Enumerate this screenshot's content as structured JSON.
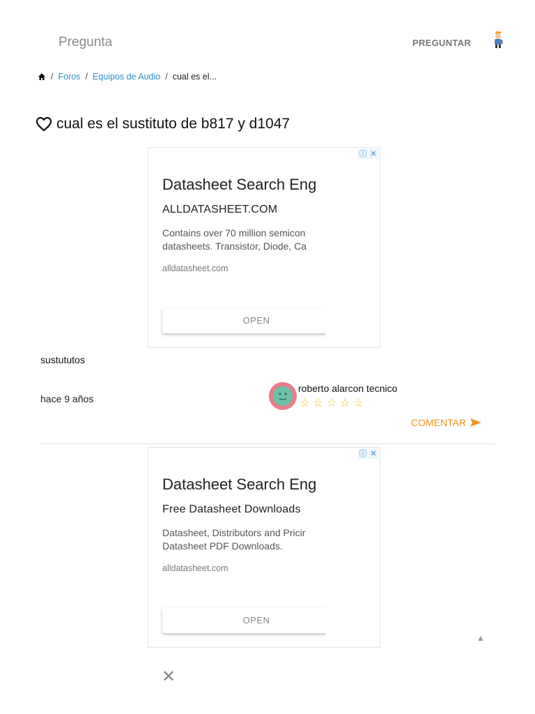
{
  "header": {
    "brand": "Pregunta",
    "ask_button": "PREGUNTAR",
    "user_icon": "worker-avatar-icon"
  },
  "breadcrumb": {
    "home_icon": "home-icon",
    "sep": "/",
    "items": [
      "Foros",
      "Equipos de Audio",
      "cual es el..."
    ]
  },
  "question": {
    "favorite_icon": "heart-outline-icon",
    "title": "cual es el sustituto de b817 y d1047"
  },
  "ads": [
    {
      "headline": "Datasheet Search Eng",
      "subhead": "ALLDATASHEET.COM",
      "desc_line1": "Contains over 70 million semicon",
      "desc_line2": "datasheets. Transistor, Diode, Ca",
      "url": "alldatasheet.com",
      "button": "OPEN",
      "badge_info": "ⓘ",
      "badge_close": "✕"
    },
    {
      "headline": "Datasheet Search Eng",
      "subhead": "Free Datasheet Downloads",
      "desc_line1": "Datasheet, Distributors and Pricir",
      "desc_line2": "Datasheet PDF Downloads.",
      "url": "alldatasheet.com",
      "button": "OPEN",
      "badge_info": "ⓘ",
      "badge_close": "✕"
    }
  ],
  "post": {
    "body": "sustututos",
    "time": "hace 9 años",
    "author": "roberto alarcon tecnico",
    "stars": "☆☆☆☆☆",
    "rating": 0,
    "comment_button": "COMENTAR"
  },
  "footer": {
    "scroll_up": "▲",
    "close": "✕"
  },
  "colors": {
    "link": "#2d8fc4",
    "accent": "#f39322",
    "star": "#f2c21d"
  }
}
